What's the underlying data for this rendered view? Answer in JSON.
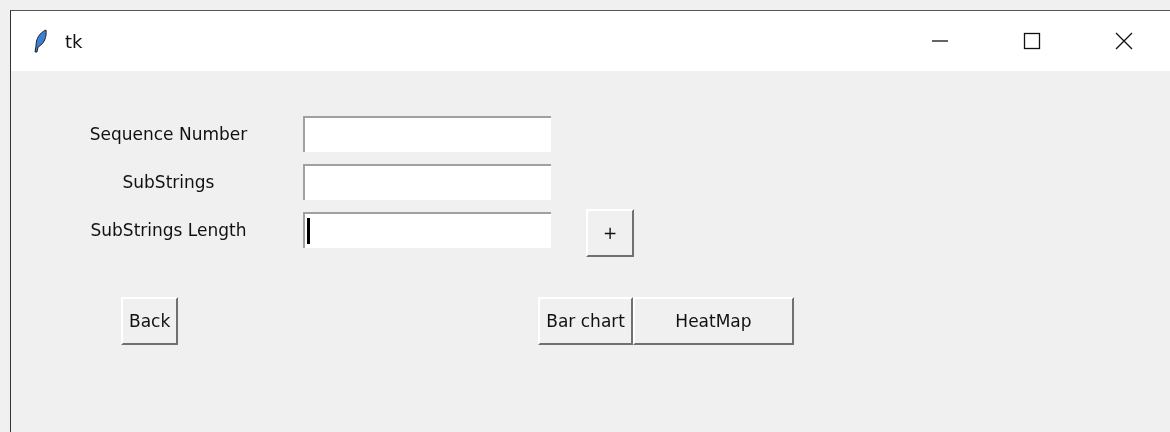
{
  "window": {
    "title": "tk"
  },
  "fields": [
    {
      "label": "Sequence Number",
      "focused": false
    },
    {
      "label": "SubStrings",
      "focused": false
    },
    {
      "label": "SubStrings Length",
      "focused": true
    }
  ],
  "add_button": "+",
  "back_button": "Back",
  "chart_buttons": [
    "Bar chart",
    "HeatMap"
  ]
}
